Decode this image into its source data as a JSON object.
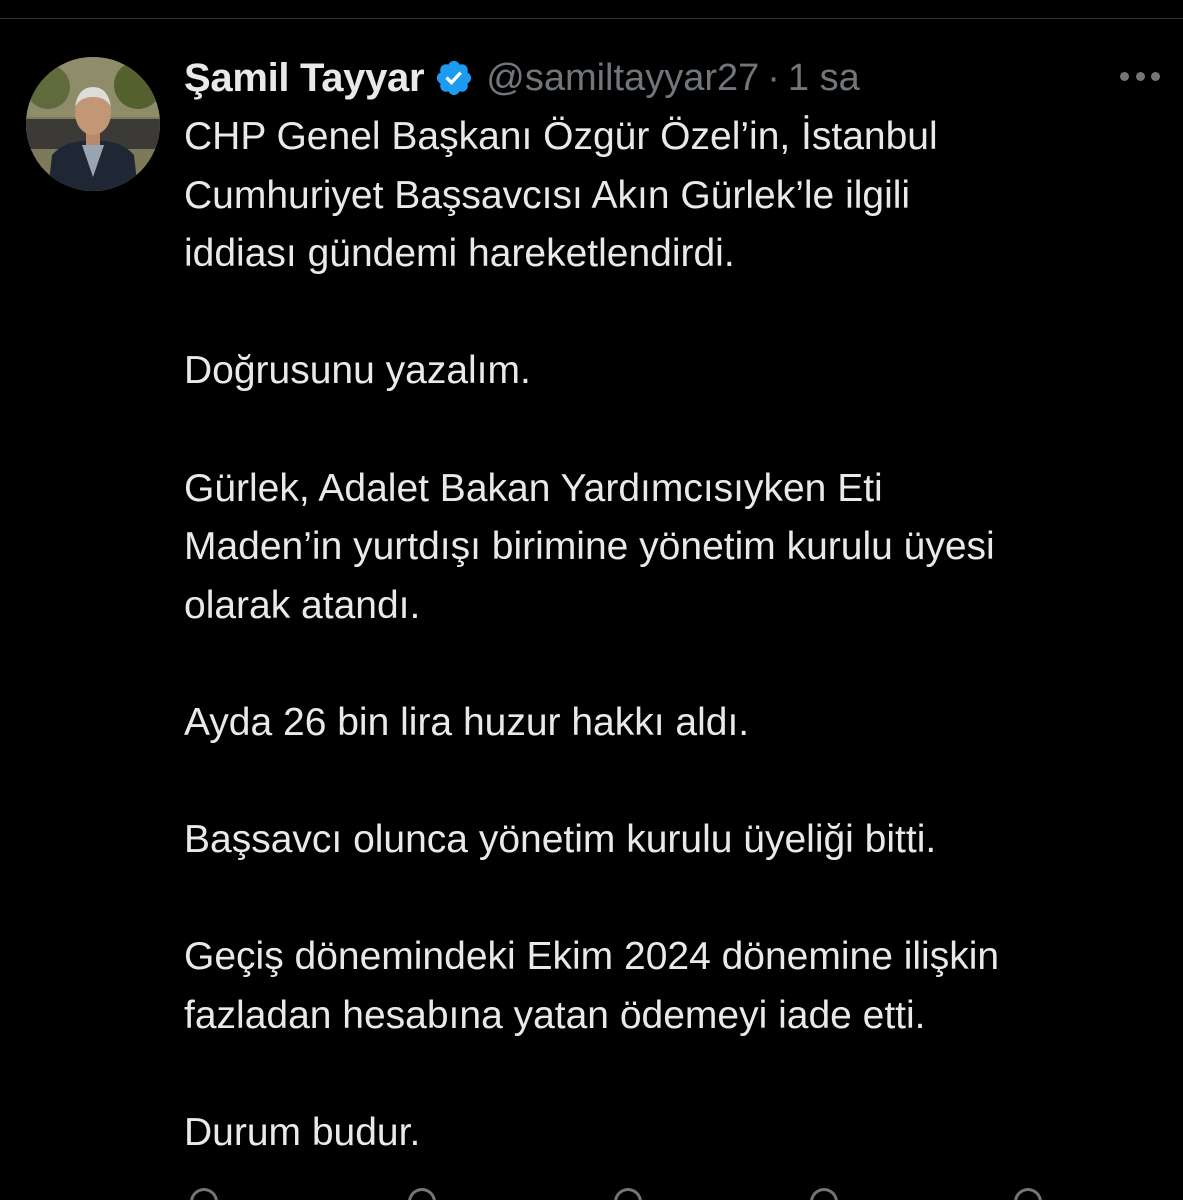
{
  "tweet": {
    "author": {
      "display_name": "Şamil Tayyar",
      "handle": "@samiltayyar27",
      "verified_icon": "verified-badge-icon",
      "avatar": "author-avatar"
    },
    "separator": "·",
    "timestamp": "1 sa",
    "more_icon": "more-options-icon",
    "paragraphs": [
      "CHP Genel Başkanı Özgür Özel’in, İstanbul\nCumhuriyet Başsavcısı Akın Gürlek’le ilgili\niddiası gündemi hareketlendirdi.",
      "Doğrusunu yazalım.",
      "Gürlek, Adalet Bakan Yardımcısıyken Eti\nMaden’in yurtdışı birimine yönetim kurulu üyesi\nolarak atandı.",
      "Ayda 26 bin lira huzur hakkı aldı.",
      "Başsavcı olunca yönetim kurulu üyeliği bitti.",
      "Geçiş dönemindeki Ekim 2024 dönemine ilişkin\nfazladan hesabına yatan ödemeyi iade etti.",
      "Durum budur."
    ]
  },
  "actions": [
    "reply-icon",
    "repost-icon",
    "like-icon",
    "views-icon",
    "share-icon"
  ],
  "colors": {
    "background": "#000000",
    "text": "#e7e9ea",
    "secondary": "#71767b",
    "verified": "#1d9bf0",
    "divider": "#2f3336"
  }
}
